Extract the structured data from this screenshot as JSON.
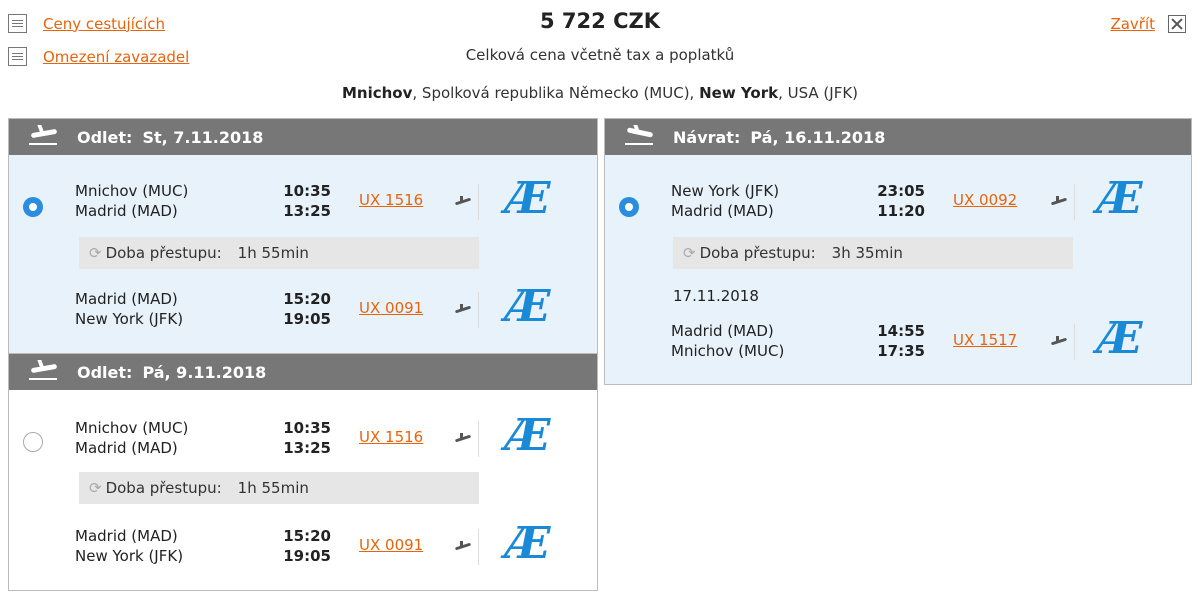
{
  "header": {
    "link_prices": "Ceny cestujících",
    "link_conditions": "Omezení zavazadel",
    "price": "5 722 CZK",
    "price_note": "Celková cena včetně tax a poplatků",
    "close_label": "Zavřít",
    "route": {
      "from_city": "Mnichov",
      "from_rest": ", Spolková republika Německo (MUC), ",
      "to_city": "New York",
      "to_rest": ", USA (JFK)"
    }
  },
  "outbound1": {
    "label": "Odlet:",
    "date": "St, 7.11.2018",
    "selected": true,
    "seg1": {
      "from": "Mnichov (MUC)",
      "to": "Madrid (MAD)",
      "dep": "10:35",
      "arr": "13:25",
      "flight": "UX 1516"
    },
    "transfer_label": "Doba přestupu:",
    "transfer_time": "1h 55min",
    "seg2": {
      "from": "Madrid (MAD)",
      "to": "New York (JFK)",
      "dep": "15:20",
      "arr": "19:05",
      "flight": "UX 0091"
    }
  },
  "outbound2": {
    "label": "Odlet:",
    "date": "Pá, 9.11.2018",
    "selected": false,
    "seg1": {
      "from": "Mnichov (MUC)",
      "to": "Madrid (MAD)",
      "dep": "10:35",
      "arr": "13:25",
      "flight": "UX 1516"
    },
    "transfer_label": "Doba přestupu:",
    "transfer_time": "1h 55min",
    "seg2": {
      "from": "Madrid (MAD)",
      "to": "New York (JFK)",
      "dep": "15:20",
      "arr": "19:05",
      "flight": "UX 0091"
    }
  },
  "return": {
    "label": "Návrat:",
    "date": "Pá, 16.11.2018",
    "selected": true,
    "seg1": {
      "from": "New York (JFK)",
      "to": "Madrid (MAD)",
      "dep": "23:05",
      "arr": "11:20",
      "flight": "UX 0092"
    },
    "transfer_label": "Doba přestupu:",
    "transfer_time": "3h 35min",
    "next_date": "17.11.2018",
    "seg2": {
      "from": "Madrid (MAD)",
      "to": "Mnichov (MUC)",
      "dep": "14:55",
      "arr": "17:35",
      "flight": "UX 1517"
    }
  },
  "airline_logo": "Æ",
  "colors": {
    "accent": "#e8640c",
    "header": "#777777",
    "selected_bg": "#e8f2fb",
    "radio": "#2a8de0",
    "logo": "#1b8ad6"
  }
}
